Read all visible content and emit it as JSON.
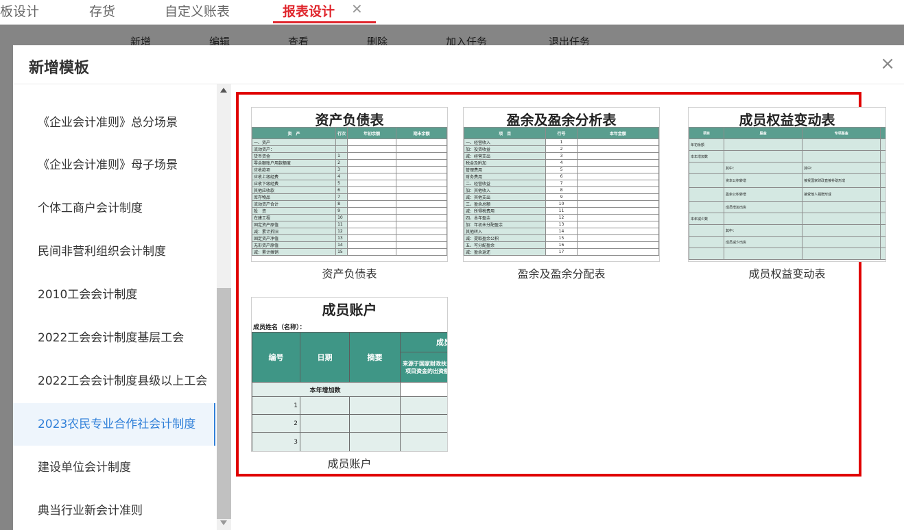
{
  "tabs": [
    {
      "label": "板设计",
      "active": false
    },
    {
      "label": "存货",
      "active": false
    },
    {
      "label": "自定义账表",
      "active": false
    },
    {
      "label": "报表设计",
      "active": true
    }
  ],
  "tab_close_glyph": "✕",
  "toolbar": [
    "新增",
    "编辑",
    "查看",
    "删除",
    "加入任务",
    "退出任务"
  ],
  "modal": {
    "title": "新增模板",
    "close_glyph": "×"
  },
  "sidebar": {
    "items": [
      {
        "label": "《企业会计准则》总分场景",
        "active": false
      },
      {
        "label": "《企业会计准则》母子场景",
        "active": false
      },
      {
        "label": "个体工商户会计制度",
        "active": false
      },
      {
        "label": "民间非营利组织会计制度",
        "active": false
      },
      {
        "label": "2010工会会计制度",
        "active": false
      },
      {
        "label": "2022工会会计制度基层工会",
        "active": false
      },
      {
        "label": "2022工会会计制度县级以上工会",
        "active": false
      },
      {
        "label": "2023农民专业合作社会计制度",
        "active": true
      },
      {
        "label": "建设单位会计制度",
        "active": false
      },
      {
        "label": "典当行业新会计准则",
        "active": false
      }
    ]
  },
  "templates": [
    {
      "title": "资产负债表",
      "label": "资产负债表"
    },
    {
      "title": "盈余及盈余分析表",
      "label": "盈余及盈余分配表"
    },
    {
      "title": "成员权益变动表",
      "label": "成员权益变动表"
    },
    {
      "title": "成员账户",
      "label": "成员账户"
    }
  ],
  "balance_sheet": {
    "headers": [
      "资　产",
      "行次",
      "年初余额",
      "期末余额"
    ],
    "rows": [
      "一、资产",
      "流动资产：",
      "货币资金",
      "零余额账户用款额度",
      "应收款项",
      "应收上级经费",
      "应收下级经费",
      "其他应收款",
      "库存物品",
      "流动资产合计",
      "投　资",
      "在建工程",
      "固定资产原值",
      "减：累计折旧",
      "固定资产净值",
      "无形资产原值",
      "减：累计摊销"
    ],
    "nums": [
      "",
      "",
      "1",
      "2",
      "3",
      "4",
      "5",
      "6",
      "7",
      "8",
      "9",
      "10",
      "11",
      "12",
      "13",
      "14",
      "15"
    ]
  },
  "surplus": {
    "headers": [
      "项　目",
      "行号",
      "本年金额"
    ],
    "rows": [
      "一、经营收入",
      "加：投资收益",
      "减：经营支出",
      "税金及附加",
      "管理费用",
      "财务费用",
      "二、经营收益",
      "加：其他收入",
      "减：其他支出",
      "三、盈余总额",
      "减：所得税费用",
      "四、本年盈余",
      "加：年初未分配盈余",
      "其他转入",
      "减：提取盈余公积",
      "五、可分配盈余",
      "减：盈余返还"
    ],
    "nums": [
      "1",
      "2",
      "3",
      "4",
      "5",
      "6",
      "7",
      "8",
      "9",
      "10",
      "11",
      "12",
      "13",
      "14",
      "15",
      "16",
      "17"
    ]
  },
  "equity": {
    "headers": [
      "项目",
      "股金",
      "专项基金"
    ],
    "rows": [
      {
        "label": "年初余额",
        "c1": "",
        "c2": ""
      },
      {
        "label": "本年增加数",
        "c1": "",
        "c2": ""
      },
      {
        "label": "",
        "c1": "其中：",
        "c2": "其中："
      },
      {
        "label": "",
        "c1": "资本公积转增",
        "c2": "接受国家财政直接补助形成"
      },
      {
        "label": "",
        "c1": "盈余公积转增",
        "c2": "接受他人捐赠形成"
      },
      {
        "label": "",
        "c1": "成员增加出资",
        "c2": ""
      },
      {
        "label": "本年减少数",
        "c1": "",
        "c2": ""
      },
      {
        "label": "",
        "c1": "其中：",
        "c2": ""
      },
      {
        "label": "",
        "c1": "成员减少出资",
        "c2": ""
      },
      {
        "label": "",
        "c1": "",
        "c2": ""
      }
    ]
  },
  "account": {
    "member_name_label": "成员姓名（名称）：",
    "headers": [
      "编号",
      "日期",
      "摘要",
      "成员",
      "来源于国家财政扶贫项目资金的出资额"
    ],
    "increase_label": "本年增加数",
    "row_nums": [
      "1",
      "2",
      "3"
    ]
  }
}
